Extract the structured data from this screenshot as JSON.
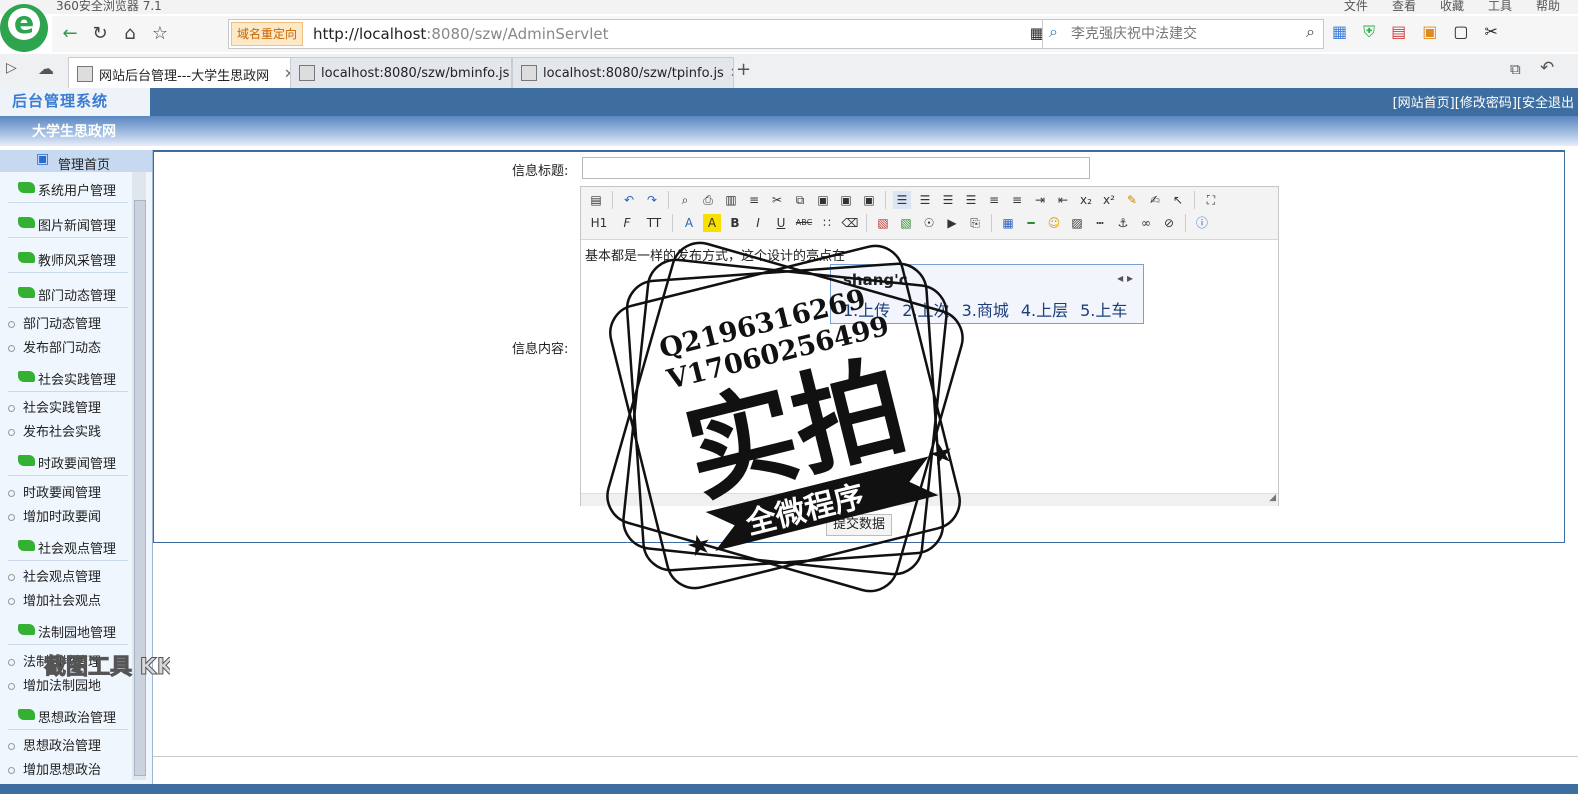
{
  "browser": {
    "title": "360安全浏览器 7.1",
    "menu": [
      "文件",
      "查看",
      "收藏",
      "工具",
      "帮助"
    ],
    "redirect_badge": "域名重定向",
    "url_host": "http://localhost",
    "url_rest": ":8080/szw/AdminServlet",
    "search_placeholder": "李克强庆祝中法建交",
    "tabs": [
      {
        "label": "网站后台管理---大学生思政网",
        "active": true
      },
      {
        "label": "localhost:8080/szw/bminfo.js",
        "active": false
      },
      {
        "label": "localhost:8080/szw/tpinfo.js",
        "active": false
      }
    ],
    "new_tab_label": "+"
  },
  "header": {
    "logo_text": "后台管理系统",
    "links": [
      "[网站首页]",
      "[修改密码]",
      "[安全退出"
    ],
    "site_name": "大学生思政网"
  },
  "sidebar": {
    "home": "管理首页",
    "sections": [
      {
        "title": "系统用户管理",
        "items": []
      },
      {
        "title": "图片新闻管理",
        "items": []
      },
      {
        "title": "教师风采管理",
        "items": []
      },
      {
        "title": "部门动态管理",
        "items": [
          "部门动态管理",
          "发布部门动态"
        ]
      },
      {
        "title": "社会实践管理",
        "items": [
          "社会实践管理",
          "发布社会实践"
        ]
      },
      {
        "title": "时政要闻管理",
        "items": [
          "时政要闻管理",
          "增加时政要闻"
        ]
      },
      {
        "title": "社会观点管理",
        "items": [
          "社会观点管理",
          "增加社会观点"
        ]
      },
      {
        "title": "法制园地管理",
        "items": [
          "法制园地管理",
          "增加法制园地"
        ]
      },
      {
        "title": "思想政治管理",
        "items": [
          "思想政治管理",
          "增加思想政治"
        ]
      }
    ]
  },
  "form": {
    "title_label": "信息标题:",
    "title_value": "",
    "content_label": "信息内容:",
    "content_value": "基本都是一样的发布方式，这个设计的亮点在",
    "submit_label": "提交数据",
    "toolbar_row2": [
      "H1",
      "F",
      "TT",
      "A",
      "A",
      "B",
      "I",
      "U",
      "ABC"
    ]
  },
  "ime": {
    "pinyin": "shang'c",
    "candidates": [
      "1.上传",
      "2.上次",
      "3.商城",
      "4.上层",
      "5.上车"
    ]
  },
  "watermark": {
    "contact_q": "Q2196316269",
    "contact_v": "V17060256499",
    "main": "实拍",
    "banner": "全微程序",
    "small_text": "截图工具 KK录像机"
  },
  "colors": {
    "header_blue": "#3e6ea0",
    "nav_flag_green": "#34b032",
    "brand_green": "#2ea44f"
  }
}
